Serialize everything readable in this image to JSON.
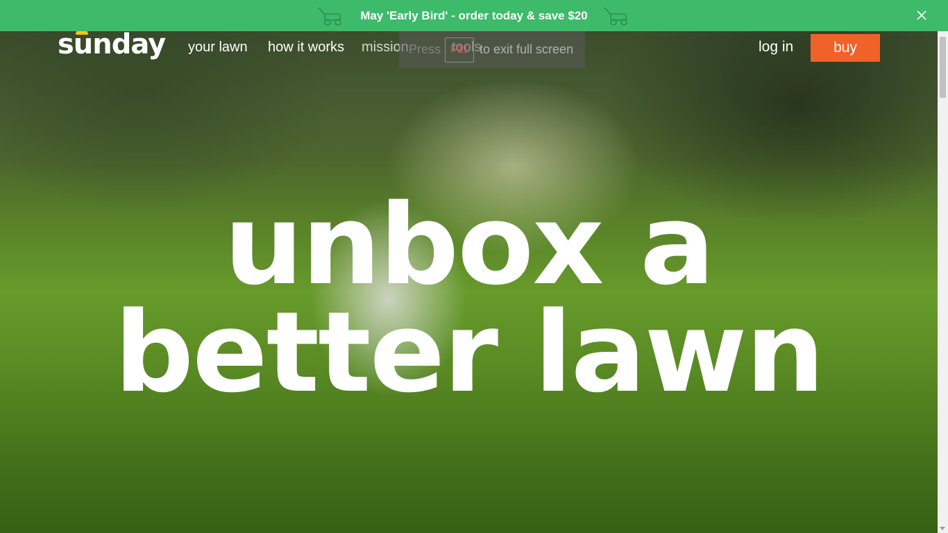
{
  "promo": {
    "text": "May 'Early Bird' - order today & save $20",
    "left_icon": "lawn-mower-icon",
    "right_icon": "lawn-mower-icon",
    "close_icon": "close-icon",
    "background": "#3dba6a"
  },
  "nav": {
    "logo": "sunday",
    "links": [
      "your lawn",
      "how it works",
      "mission",
      "tools"
    ],
    "login": "log in",
    "buy": "buy",
    "buy_color": "#f0622a"
  },
  "fullscreen_toast": {
    "press": "Press",
    "key": "F11",
    "rest": "to exit full screen"
  },
  "hero": {
    "line1": "unbox a",
    "line2": "better lawn"
  }
}
